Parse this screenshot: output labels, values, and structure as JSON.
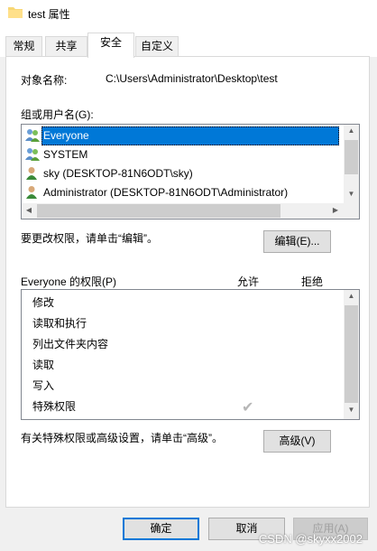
{
  "window": {
    "title": "test 属性"
  },
  "tabs": [
    {
      "label": "常规"
    },
    {
      "label": "共享"
    },
    {
      "label": "安全"
    },
    {
      "label": "自定义"
    }
  ],
  "object": {
    "label": "对象名称:",
    "value": "C:\\Users\\Administrator\\Desktop\\test"
  },
  "groups": {
    "label": "组或用户名(G):",
    "items": [
      {
        "name": "Everyone",
        "icon": "group-users-icon",
        "selected": true
      },
      {
        "name": "SYSTEM",
        "icon": "group-users-icon",
        "selected": false
      },
      {
        "name": "sky (DESKTOP-81N6ODT\\sky)",
        "icon": "user-icon",
        "selected": false
      },
      {
        "name": "Administrator (DESKTOP-81N6ODT\\Administrator)",
        "icon": "user-icon",
        "selected": false
      }
    ]
  },
  "change_hint": "要更改权限，请单击“编辑”。",
  "edit_button": "编辑(E)...",
  "permissions": {
    "title": "Everyone 的权限(P)",
    "allow_header": "允许",
    "deny_header": "拒绝",
    "items": [
      {
        "name": "修改",
        "allow": false,
        "deny": false
      },
      {
        "name": "读取和执行",
        "allow": false,
        "deny": false
      },
      {
        "name": "列出文件夹内容",
        "allow": false,
        "deny": false
      },
      {
        "name": "读取",
        "allow": false,
        "deny": false
      },
      {
        "name": "写入",
        "allow": false,
        "deny": false
      },
      {
        "name": "特殊权限",
        "allow": true,
        "deny": false
      }
    ]
  },
  "advanced_hint": "有关特殊权限或高级设置，请单击“高级”。",
  "advanced_button": "高级(V)",
  "footer": {
    "ok": "确定",
    "cancel": "取消",
    "apply": "应用(A)"
  },
  "watermark": "CSDN @skyxx2002",
  "colors": {
    "selection": "#0078d7",
    "accent_border": "#0078d7"
  }
}
